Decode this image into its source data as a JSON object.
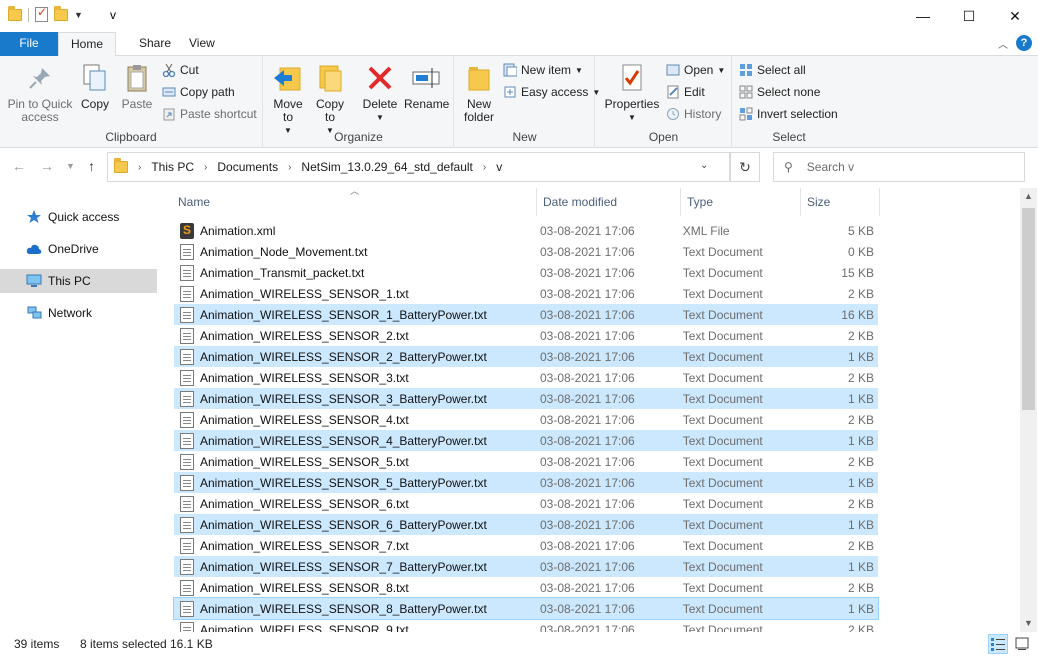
{
  "window": {
    "title": "v"
  },
  "ribbon_tabs": {
    "file": "File",
    "home": "Home",
    "share": "Share",
    "view": "View"
  },
  "clipboard": {
    "label": "Clipboard",
    "pin": "Pin to Quick access",
    "copy": "Copy",
    "paste": "Paste",
    "cut": "Cut",
    "copy_path": "Copy path",
    "paste_shortcut": "Paste shortcut"
  },
  "organize": {
    "label": "Organize",
    "move_to": "Move to",
    "copy_to": "Copy to",
    "delete": "Delete",
    "rename": "Rename"
  },
  "new_group": {
    "label": "New",
    "new_folder": "New folder",
    "new_item": "New item",
    "easy_access": "Easy access"
  },
  "open_group": {
    "label": "Open",
    "properties": "Properties",
    "open": "Open",
    "edit": "Edit",
    "history": "History"
  },
  "select_group": {
    "label": "Select",
    "select_all": "Select all",
    "select_none": "Select none",
    "invert": "Invert selection"
  },
  "address": {
    "crumbs": [
      "This PC",
      "Documents",
      "NetSim_13.0.29_64_std_default",
      "v"
    ],
    "search_placeholder": "Search v"
  },
  "sidebar": {
    "items": [
      {
        "label": "Quick access",
        "icon": "star-icon"
      },
      {
        "label": "OneDrive",
        "icon": "cloud-icon"
      },
      {
        "label": "This PC",
        "icon": "computer-icon"
      },
      {
        "label": "Network",
        "icon": "network-icon"
      }
    ]
  },
  "columns": {
    "name": "Name",
    "date": "Date modified",
    "type": "Type",
    "size": "Size"
  },
  "files": [
    {
      "name": "Animation.xml",
      "date": "03-08-2021 17:06",
      "type": "XML File",
      "size": "5 KB",
      "icon": "xml",
      "selected": false
    },
    {
      "name": "Animation_Node_Movement.txt",
      "date": "03-08-2021 17:06",
      "type": "Text Document",
      "size": "0 KB",
      "icon": "txt",
      "selected": false
    },
    {
      "name": "Animation_Transmit_packet.txt",
      "date": "03-08-2021 17:06",
      "type": "Text Document",
      "size": "15 KB",
      "icon": "txt",
      "selected": false
    },
    {
      "name": "Animation_WIRELESS_SENSOR_1.txt",
      "date": "03-08-2021 17:06",
      "type": "Text Document",
      "size": "2 KB",
      "icon": "txt",
      "selected": false
    },
    {
      "name": "Animation_WIRELESS_SENSOR_1_BatteryPower.txt",
      "date": "03-08-2021 17:06",
      "type": "Text Document",
      "size": "16 KB",
      "icon": "txt",
      "selected": true
    },
    {
      "name": "Animation_WIRELESS_SENSOR_2.txt",
      "date": "03-08-2021 17:06",
      "type": "Text Document",
      "size": "2 KB",
      "icon": "txt",
      "selected": false
    },
    {
      "name": "Animation_WIRELESS_SENSOR_2_BatteryPower.txt",
      "date": "03-08-2021 17:06",
      "type": "Text Document",
      "size": "1 KB",
      "icon": "txt",
      "selected": true
    },
    {
      "name": "Animation_WIRELESS_SENSOR_3.txt",
      "date": "03-08-2021 17:06",
      "type": "Text Document",
      "size": "2 KB",
      "icon": "txt",
      "selected": false
    },
    {
      "name": "Animation_WIRELESS_SENSOR_3_BatteryPower.txt",
      "date": "03-08-2021 17:06",
      "type": "Text Document",
      "size": "1 KB",
      "icon": "txt",
      "selected": true
    },
    {
      "name": "Animation_WIRELESS_SENSOR_4.txt",
      "date": "03-08-2021 17:06",
      "type": "Text Document",
      "size": "2 KB",
      "icon": "txt",
      "selected": false
    },
    {
      "name": "Animation_WIRELESS_SENSOR_4_BatteryPower.txt",
      "date": "03-08-2021 17:06",
      "type": "Text Document",
      "size": "1 KB",
      "icon": "txt",
      "selected": true
    },
    {
      "name": "Animation_WIRELESS_SENSOR_5.txt",
      "date": "03-08-2021 17:06",
      "type": "Text Document",
      "size": "2 KB",
      "icon": "txt",
      "selected": false
    },
    {
      "name": "Animation_WIRELESS_SENSOR_5_BatteryPower.txt",
      "date": "03-08-2021 17:06",
      "type": "Text Document",
      "size": "1 KB",
      "icon": "txt",
      "selected": true
    },
    {
      "name": "Animation_WIRELESS_SENSOR_6.txt",
      "date": "03-08-2021 17:06",
      "type": "Text Document",
      "size": "2 KB",
      "icon": "txt",
      "selected": false
    },
    {
      "name": "Animation_WIRELESS_SENSOR_6_BatteryPower.txt",
      "date": "03-08-2021 17:06",
      "type": "Text Document",
      "size": "1 KB",
      "icon": "txt",
      "selected": true
    },
    {
      "name": "Animation_WIRELESS_SENSOR_7.txt",
      "date": "03-08-2021 17:06",
      "type": "Text Document",
      "size": "2 KB",
      "icon": "txt",
      "selected": false
    },
    {
      "name": "Animation_WIRELESS_SENSOR_7_BatteryPower.txt",
      "date": "03-08-2021 17:06",
      "type": "Text Document",
      "size": "1 KB",
      "icon": "txt",
      "selected": true
    },
    {
      "name": "Animation_WIRELESS_SENSOR_8.txt",
      "date": "03-08-2021 17:06",
      "type": "Text Document",
      "size": "2 KB",
      "icon": "txt",
      "selected": false
    },
    {
      "name": "Animation_WIRELESS_SENSOR_8_BatteryPower.txt",
      "date": "03-08-2021 17:06",
      "type": "Text Document",
      "size": "1 KB",
      "icon": "txt",
      "selected": true
    },
    {
      "name": "Animation_WIRELESS_SENSOR_9.txt",
      "date": "03-08-2021 17:06",
      "type": "Text Document",
      "size": "2 KB",
      "icon": "txt",
      "selected": false
    }
  ],
  "status": {
    "items": "39 items",
    "selected": "8 items selected",
    "size": "16.1 KB"
  },
  "colors": {
    "accent": "#1979ca",
    "selection": "#cce8ff"
  }
}
